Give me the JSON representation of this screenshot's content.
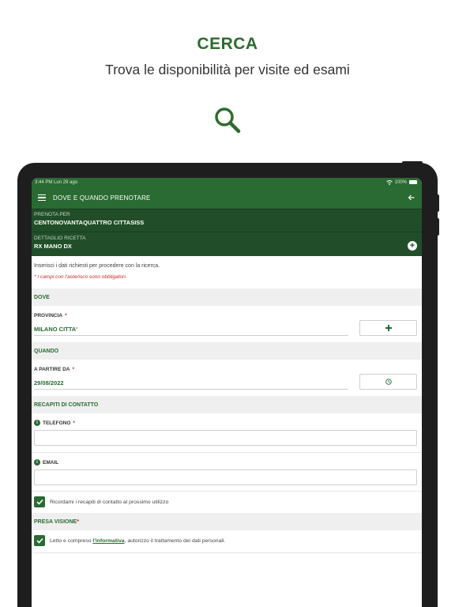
{
  "promo": {
    "headline": "CERCA",
    "subheadline": "Trova le disponibilità per visite ed esami",
    "hero_icon": "search-icon"
  },
  "statusbar": {
    "time_date": "3:44 PM   Lun 29 ago",
    "battery": "100%"
  },
  "appbar": {
    "title": "DOVE E QUANDO PRENOTARE"
  },
  "booking_for": {
    "label": "PRENOTA PER",
    "value": "CENTONOVANTAQUATTRO CITTASISS"
  },
  "prescription": {
    "label": "DETTAGLIO RICETTA",
    "value": "RX MANO DX"
  },
  "intro_text": "Inserisci i dati richiesti per procedere con la ricerca.",
  "mandatory_note": "* I campi con l'asterisco sono obbligatori.",
  "sections": {
    "where": "DOVE",
    "when": "QUANDO",
    "contacts": "RECAPITI DI CONTATTO",
    "consent": "PRESA VISIONE"
  },
  "fields": {
    "province_label": "PROVINCIA",
    "province_value": "MILANO CITTA'",
    "from_label": "A PARTIRE DA",
    "from_value": "29/08/2022",
    "phone_label": "TELEFONO",
    "phone_value": "",
    "email_label": "EMAIL",
    "email_value": "",
    "required_mark": "*"
  },
  "remember_contacts": {
    "checked": true,
    "label": "Ricordami i recapiti di contatto al prossimo utilizzo"
  },
  "consent": {
    "checked": true,
    "text_before": "Letto e compreso ",
    "link": "l'informativa",
    "text_after": ", autorizzo il trattamento dei dati personali."
  },
  "colors": {
    "primary_green": "#2a6a33",
    "dark_green": "#214e29",
    "required_red": "#c62828"
  }
}
